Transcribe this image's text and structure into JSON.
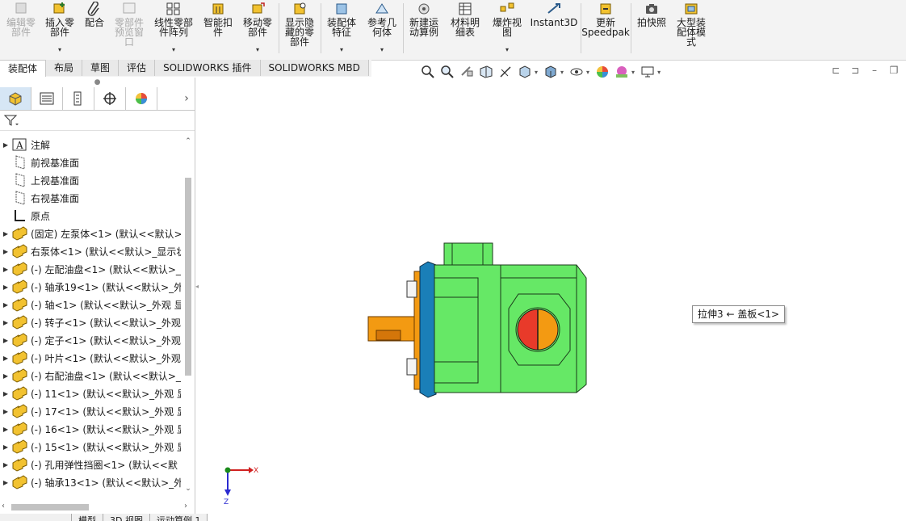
{
  "ribbon": {
    "buttons": [
      {
        "label": "编辑零\n部件",
        "enabled": false
      },
      {
        "label": "插入零\n部件"
      },
      {
        "label": "配合"
      },
      {
        "label": "零部件\n预览窗\n口",
        "enabled": false
      },
      {
        "label": "线性零部\n件阵列"
      },
      {
        "label": "智能扣\n件"
      },
      {
        "label": "移动零\n部件"
      },
      {
        "label": "显示隐\n藏的零\n部件"
      },
      {
        "label": "装配体\n特征"
      },
      {
        "label": "参考几\n何体"
      },
      {
        "label": "新建运\n动算例"
      },
      {
        "label": "材料明\n细表"
      },
      {
        "label": "爆炸视\n图"
      },
      {
        "label": "Instant3D"
      },
      {
        "label": "更新\nSpeedpak"
      },
      {
        "label": "拍快照"
      },
      {
        "label": "大型装\n配体模\n式"
      }
    ]
  },
  "tabs": [
    "装配体",
    "布局",
    "草图",
    "评估",
    "SOLIDWORKS 插件",
    "SOLIDWORKS MBD"
  ],
  "active_tab": "装配体",
  "feature_tree": {
    "items": [
      {
        "label": "注解",
        "icon": "annotation-icon",
        "expandable": true
      },
      {
        "label": "前视基准面",
        "icon": "plane-icon",
        "expandable": false
      },
      {
        "label": "上视基准面",
        "icon": "plane-icon",
        "expandable": false
      },
      {
        "label": "右视基准面",
        "icon": "plane-icon",
        "expandable": false
      },
      {
        "label": "原点",
        "icon": "origin-icon",
        "expandable": false
      },
      {
        "label": "(固定) 左泵体<1> (默认<<默认>_",
        "icon": "part-icon",
        "expandable": true
      },
      {
        "label": "右泵体<1> (默认<<默认>_显示状",
        "icon": "part-icon",
        "expandable": true
      },
      {
        "label": "(-) 左配油盘<1> (默认<<默认>_",
        "icon": "part-icon",
        "expandable": true
      },
      {
        "label": "(-) 轴承19<1> (默认<<默认>_外",
        "icon": "part-icon",
        "expandable": true
      },
      {
        "label": "(-) 轴<1> (默认<<默认>_外观 显",
        "icon": "part-icon",
        "expandable": true
      },
      {
        "label": "(-) 转子<1> (默认<<默认>_外观",
        "icon": "part-icon",
        "expandable": true
      },
      {
        "label": "(-) 定子<1> (默认<<默认>_外观",
        "icon": "part-icon",
        "expandable": true
      },
      {
        "label": "(-) 叶片<1> (默认<<默认>_外观",
        "icon": "part-icon",
        "expandable": true
      },
      {
        "label": "(-) 右配油盘<1> (默认<<默认>_",
        "icon": "part-icon",
        "expandable": true
      },
      {
        "label": "(-) 11<1> (默认<<默认>_外观 显",
        "icon": "part-icon",
        "expandable": true
      },
      {
        "label": "(-) 17<1> (默认<<默认>_外观 显",
        "icon": "part-icon",
        "expandable": true
      },
      {
        "label": "(-) 16<1> (默认<<默认>_外观 显",
        "icon": "part-icon",
        "expandable": true
      },
      {
        "label": "(-) 15<1> (默认<<默认>_外观 显",
        "icon": "part-icon",
        "expandable": true
      },
      {
        "label": "(-) 孔用弹性挡圈<1> (默认<<默",
        "icon": "part-icon",
        "expandable": true
      },
      {
        "label": "(-) 轴承13<1> (默认<<默认>_外",
        "icon": "part-icon",
        "expandable": true
      }
    ]
  },
  "bottom_tabs": [
    "模型",
    "3D 视图",
    "运动算例 1"
  ],
  "tooltip": {
    "text": "拉伸3 ← 盖板<1>"
  },
  "triad": {
    "x_label": "X",
    "z_label": "Z"
  },
  "colors": {
    "body_green": "#66e866",
    "flange_blue": "#1a7fb8",
    "shaft_orange": "#f39a12",
    "cap_red": "#e83a2a",
    "active_tab_bg": "#ffffff"
  }
}
